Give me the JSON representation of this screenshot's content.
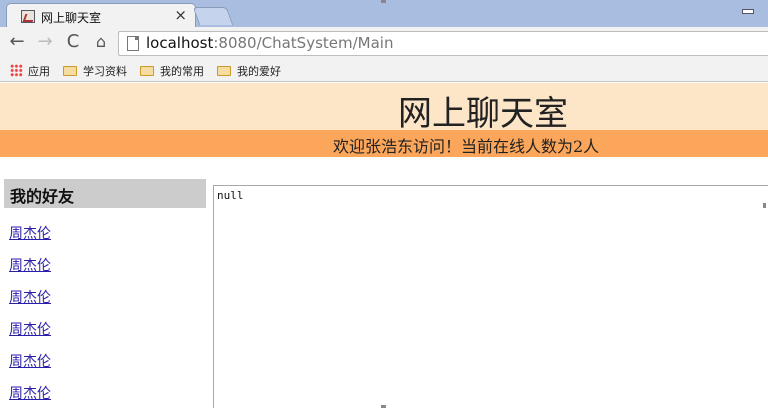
{
  "browser": {
    "tab": {
      "title": "网上聊天室",
      "close_glyph": "×"
    },
    "nav": {
      "back": "←",
      "forward": "→",
      "reload": "C",
      "home": "⌂"
    },
    "address": {
      "host": "localhost",
      "path": ":8080/ChatSystem/Main"
    },
    "bookmarks": [
      {
        "label": "应用",
        "icon": "apps-grid-icon"
      },
      {
        "label": "学习资料",
        "icon": "folder-icon"
      },
      {
        "label": "我的常用",
        "icon": "folder-icon"
      },
      {
        "label": "我的爱好",
        "icon": "folder-icon"
      }
    ]
  },
  "page": {
    "title": "网上聊天室",
    "welcome": "欢迎张浩东访问！当前在线人数为2人",
    "friends": {
      "heading": "我的好友",
      "items": [
        "周杰伦",
        "周杰伦",
        "周杰伦",
        "周杰伦",
        "周杰伦",
        "周杰伦"
      ]
    },
    "chat": {
      "content": "null"
    }
  },
  "colors": {
    "header_bg": "#fde6c8",
    "welcome_bg": "#fba65a",
    "friends_header_bg": "#cccccc",
    "link": "#2a1ea8"
  }
}
